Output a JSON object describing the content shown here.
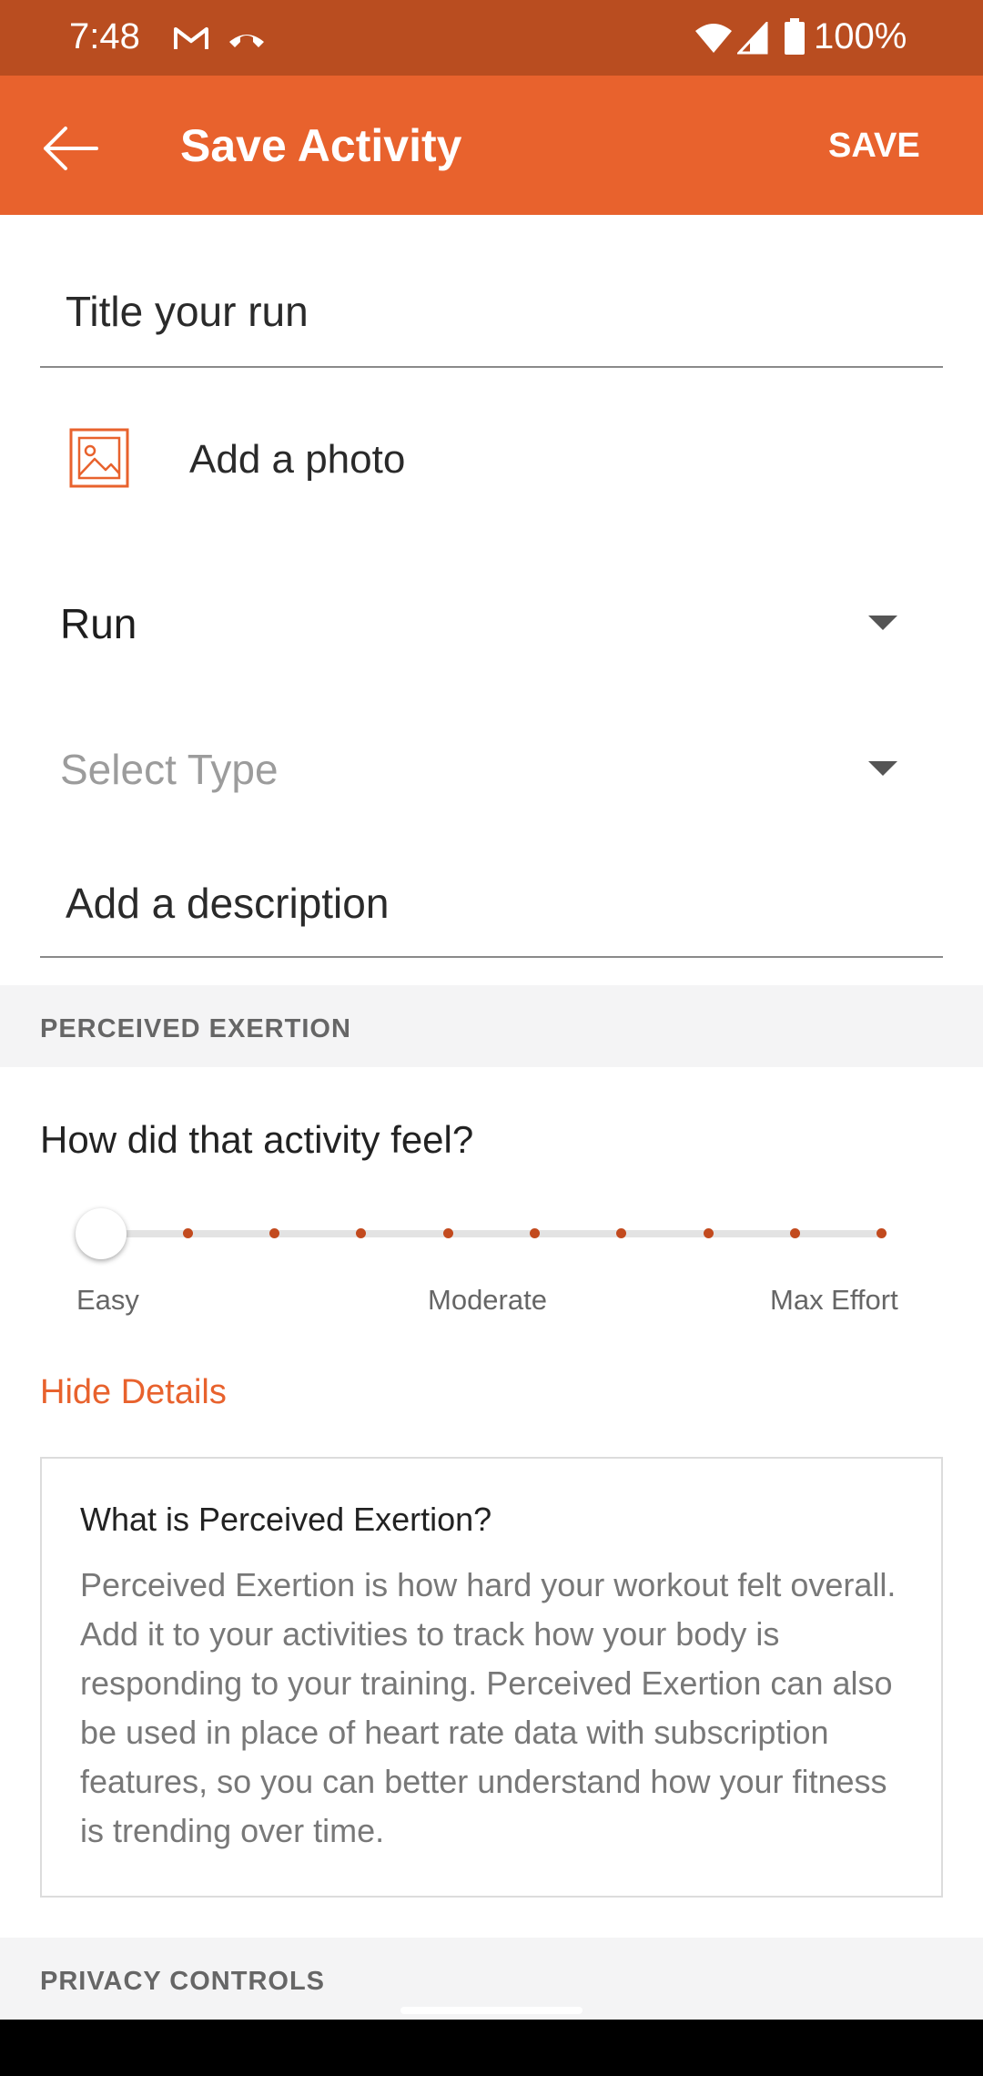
{
  "status_bar": {
    "time": "7:48",
    "battery_text": "100%",
    "icons": [
      "gmail-icon",
      "missed-call-icon",
      "wifi-icon",
      "signal-icon",
      "battery-icon"
    ]
  },
  "app_bar": {
    "title": "Save Activity",
    "save_label": "SAVE",
    "back_icon": "back-arrow-icon"
  },
  "form": {
    "title_placeholder": "Title your run",
    "photo_label": "Add a photo",
    "activity_value": "Run",
    "type_placeholder": "Select Type",
    "description_placeholder": "Add a description"
  },
  "perceived_exertion": {
    "header": "PERCEIVED EXERTION",
    "question": "How did that activity feel?",
    "slider": {
      "steps": 10,
      "selected_step": 1,
      "labels": [
        "Easy",
        "Moderate",
        "Max Effort"
      ]
    },
    "hide_details_label": "Hide Details",
    "info_title": "What is Perceived Exertion?",
    "info_body": "Perceived Exertion is how hard your workout felt overall. Add it to your activities to track how your body is responding to your training. Perceived Exertion can also be used in place of heart rate data with subscription features, so you can better understand how your fitness is trending over time."
  },
  "privacy": {
    "header": "PRIVACY CONTROLS"
  },
  "colors": {
    "status_bar": "#b94d20",
    "brand": "#e8622d",
    "slider_dot": "#c24a1e",
    "section_bg": "#f4f4f5"
  }
}
